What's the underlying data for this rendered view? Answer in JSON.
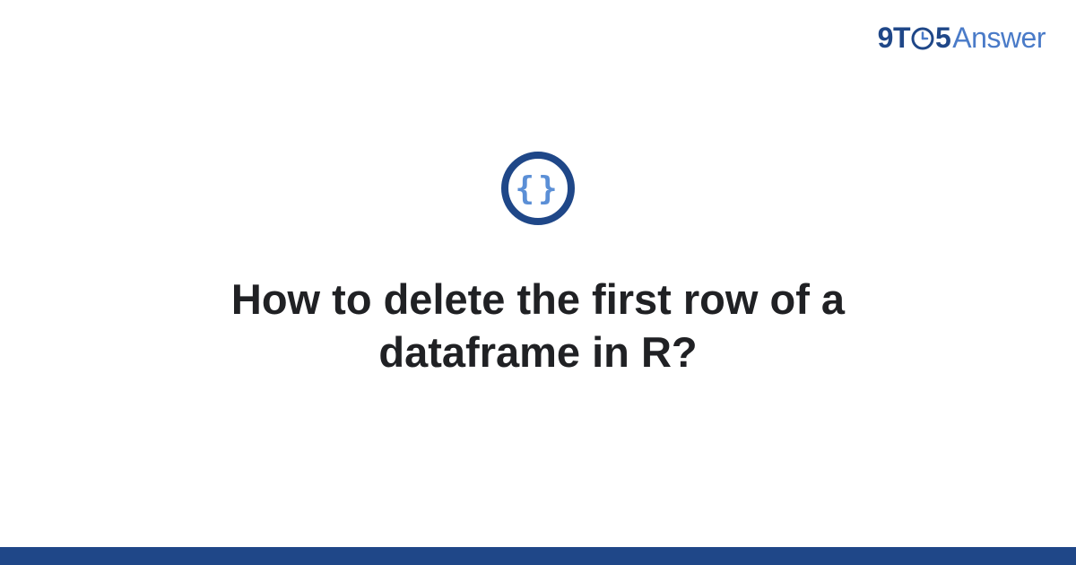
{
  "brand": {
    "part_9t": "9T",
    "part_5": "5",
    "part_answer": "Answer"
  },
  "icon": {
    "semantic": "code-braces-icon",
    "glyph_left": "{",
    "glyph_right": "}"
  },
  "question": {
    "title": "How to delete the first row of a dataframe in R?"
  },
  "colors": {
    "brand_dark": "#1f4788",
    "brand_light": "#4a7bc8",
    "text": "#202124",
    "footer": "#1f4788"
  }
}
